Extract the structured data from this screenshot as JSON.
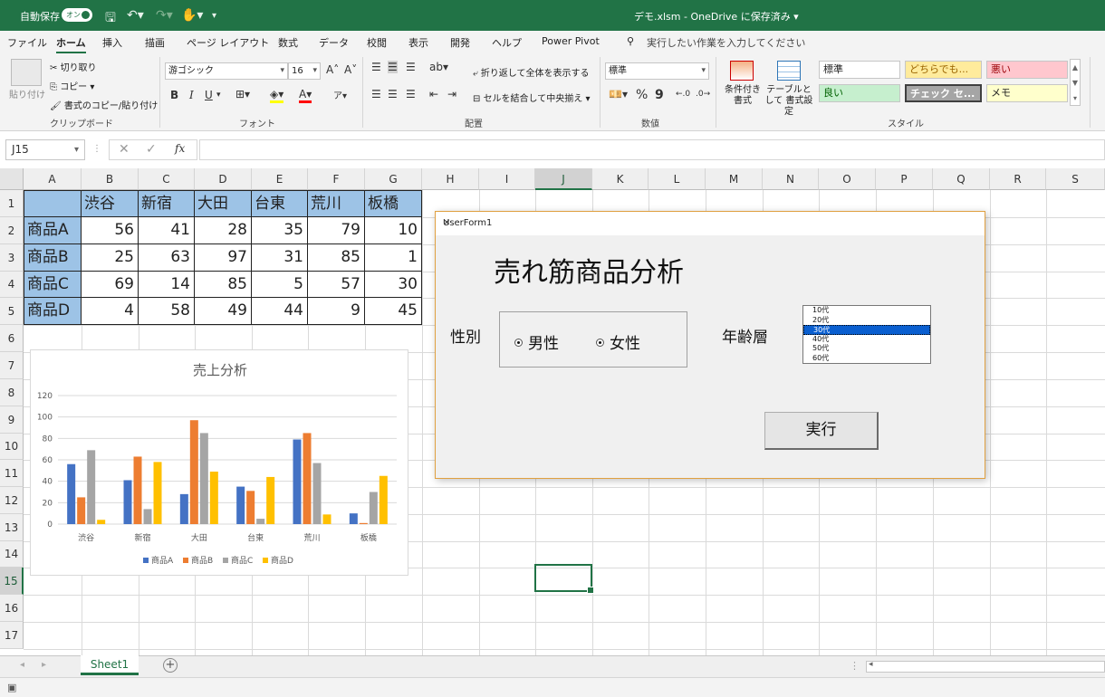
{
  "titlebar": {
    "autosave_label": "自動保存",
    "autosave_state": "オン",
    "document_title": "デモ.xlsm - OneDrive に保存済み ▾"
  },
  "tabs": [
    "ファイル",
    "ホーム",
    "挿入",
    "描画",
    "ページ レイアウト",
    "数式",
    "データ",
    "校閲",
    "表示",
    "開発",
    "ヘルプ",
    "Power Pivot"
  ],
  "active_tab": "ホーム",
  "tell_me": "実行したい作業を入力してください",
  "ribbon": {
    "clipboard": {
      "paste": "貼り付け",
      "cut": "切り取り",
      "copy": "コピー",
      "format_painter": "書式のコピー/貼り付け",
      "label": "クリップボード"
    },
    "font": {
      "name": "游ゴシック",
      "size": "16",
      "label": "フォント",
      "bold": "B",
      "italic": "I",
      "underline": "U"
    },
    "alignment": {
      "wrap": "折り返して全体を表示する",
      "merge": "セルを結合して中央揃え",
      "label": "配置"
    },
    "number": {
      "format": "標準",
      "label": "数値",
      "percent": "%",
      "comma": "9"
    },
    "styles": {
      "conditional": "条件付き 書式",
      "table": "テーブルとして 書式設定",
      "label": "スタイル",
      "cells": [
        {
          "text": "標準",
          "bg": "#ffffff",
          "fg": "#222222"
        },
        {
          "text": "どちらでも...",
          "bg": "#ffeb9c",
          "fg": "#9c6500"
        },
        {
          "text": "悪い",
          "bg": "#ffc7ce",
          "fg": "#9c0006"
        },
        {
          "text": "良い",
          "bg": "#c6efce",
          "fg": "#006100"
        },
        {
          "text": "チェック セ...",
          "bg": "#a5a5a5",
          "fg": "#ffffff"
        },
        {
          "text": "メモ",
          "bg": "#ffffcc",
          "fg": "#222222"
        }
      ]
    }
  },
  "formula_bar": {
    "name_box": "J15",
    "fx": "fx",
    "formula": ""
  },
  "columns": [
    "A",
    "B",
    "C",
    "D",
    "E",
    "F",
    "G",
    "H",
    "I",
    "J",
    "K",
    "L",
    "M",
    "N",
    "O",
    "P",
    "Q",
    "R",
    "S"
  ],
  "rows": [
    "1",
    "2",
    "3",
    "4",
    "5",
    "6",
    "7",
    "8",
    "9",
    "10",
    "11",
    "12",
    "13",
    "14",
    "15",
    "16",
    "17"
  ],
  "selected_cell": "J15",
  "table": {
    "headers": [
      "渋谷",
      "新宿",
      "大田",
      "台東",
      "荒川",
      "板橋"
    ],
    "rows": [
      {
        "label": "商品A",
        "values": [
          "56",
          "41",
          "28",
          "35",
          "79",
          "10"
        ]
      },
      {
        "label": "商品B",
        "values": [
          "25",
          "63",
          "97",
          "31",
          "85",
          "1"
        ]
      },
      {
        "label": "商品C",
        "values": [
          "69",
          "14",
          "85",
          "5",
          "57",
          "30"
        ]
      },
      {
        "label": "商品D",
        "values": [
          "4",
          "58",
          "49",
          "44",
          "9",
          "45"
        ]
      }
    ]
  },
  "chart_data": {
    "type": "bar",
    "title": "売上分析",
    "categories": [
      "渋谷",
      "新宿",
      "大田",
      "台東",
      "荒川",
      "板橋"
    ],
    "series": [
      {
        "name": "商品A",
        "values": [
          56,
          41,
          28,
          35,
          79,
          10
        ],
        "color": "#4472c4"
      },
      {
        "name": "商品B",
        "values": [
          25,
          63,
          97,
          31,
          85,
          1
        ],
        "color": "#ed7d31"
      },
      {
        "name": "商品C",
        "values": [
          69,
          14,
          85,
          5,
          57,
          30
        ],
        "color": "#a5a5a5"
      },
      {
        "name": "商品D",
        "values": [
          4,
          58,
          49,
          44,
          9,
          45
        ],
        "color": "#ffc000"
      }
    ],
    "ylim": [
      0,
      120
    ],
    "yticks": [
      "0",
      "20",
      "40",
      "60",
      "80",
      "100",
      "120"
    ],
    "grid": true,
    "legend": "bottom"
  },
  "userform": {
    "title": "UserForm1",
    "heading": "売れ筋商品分析",
    "gender_label": "性別",
    "male": "男性",
    "female": "女性",
    "age_label": "年齢層",
    "ages": [
      "10代",
      "20代",
      "30代",
      "40代",
      "50代",
      "60代"
    ],
    "selected_age": "30代",
    "run_button": "実行"
  },
  "sheet_tab": "Sheet1"
}
